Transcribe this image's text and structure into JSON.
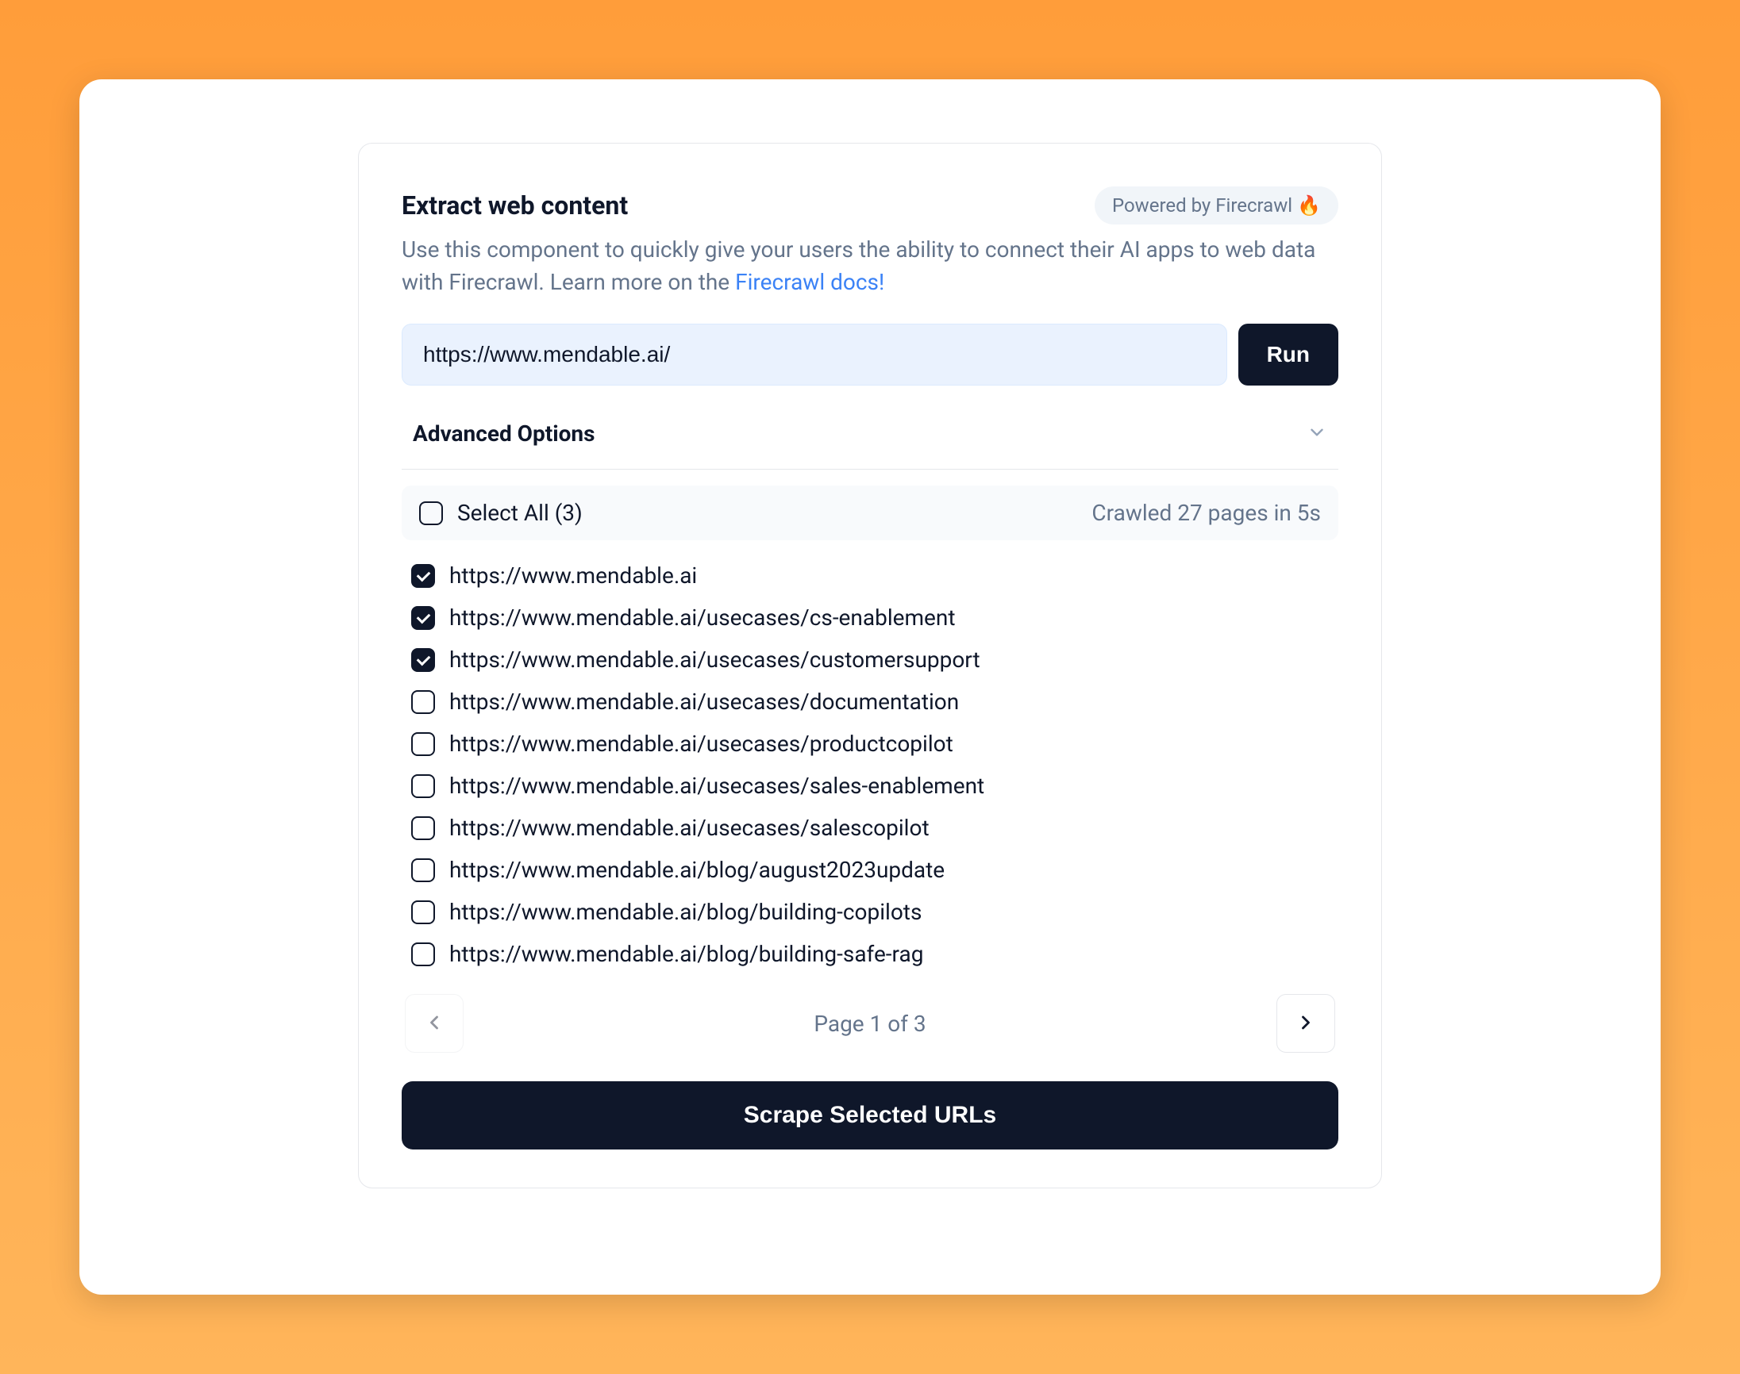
{
  "header": {
    "title": "Extract web content",
    "badge_text": "Powered by Firecrawl",
    "fire_emoji": "🔥"
  },
  "description": {
    "text_before": "Use this component to quickly give your users the ability to connect their AI apps to web data with Firecrawl. Learn more on the ",
    "link_text": "Firecrawl docs!"
  },
  "input": {
    "url_value": "https://www.mendable.ai/",
    "run_label": "Run"
  },
  "advanced": {
    "label": "Advanced Options"
  },
  "select_bar": {
    "select_all_label": "Select All (3)",
    "status": "Crawled 27 pages in 5s"
  },
  "urls": [
    {
      "url": "https://www.mendable.ai",
      "checked": true
    },
    {
      "url": "https://www.mendable.ai/usecases/cs-enablement",
      "checked": true
    },
    {
      "url": "https://www.mendable.ai/usecases/customersupport",
      "checked": true
    },
    {
      "url": "https://www.mendable.ai/usecases/documentation",
      "checked": false
    },
    {
      "url": "https://www.mendable.ai/usecases/productcopilot",
      "checked": false
    },
    {
      "url": "https://www.mendable.ai/usecases/sales-enablement",
      "checked": false
    },
    {
      "url": "https://www.mendable.ai/usecases/salescopilot",
      "checked": false
    },
    {
      "url": "https://www.mendable.ai/blog/august2023update",
      "checked": false
    },
    {
      "url": "https://www.mendable.ai/blog/building-copilots",
      "checked": false
    },
    {
      "url": "https://www.mendable.ai/blog/building-safe-rag",
      "checked": false
    }
  ],
  "pagination": {
    "label": "Page 1 of 3",
    "prev_disabled": true,
    "next_disabled": false
  },
  "cta": {
    "scrape_label": "Scrape Selected URLs"
  }
}
